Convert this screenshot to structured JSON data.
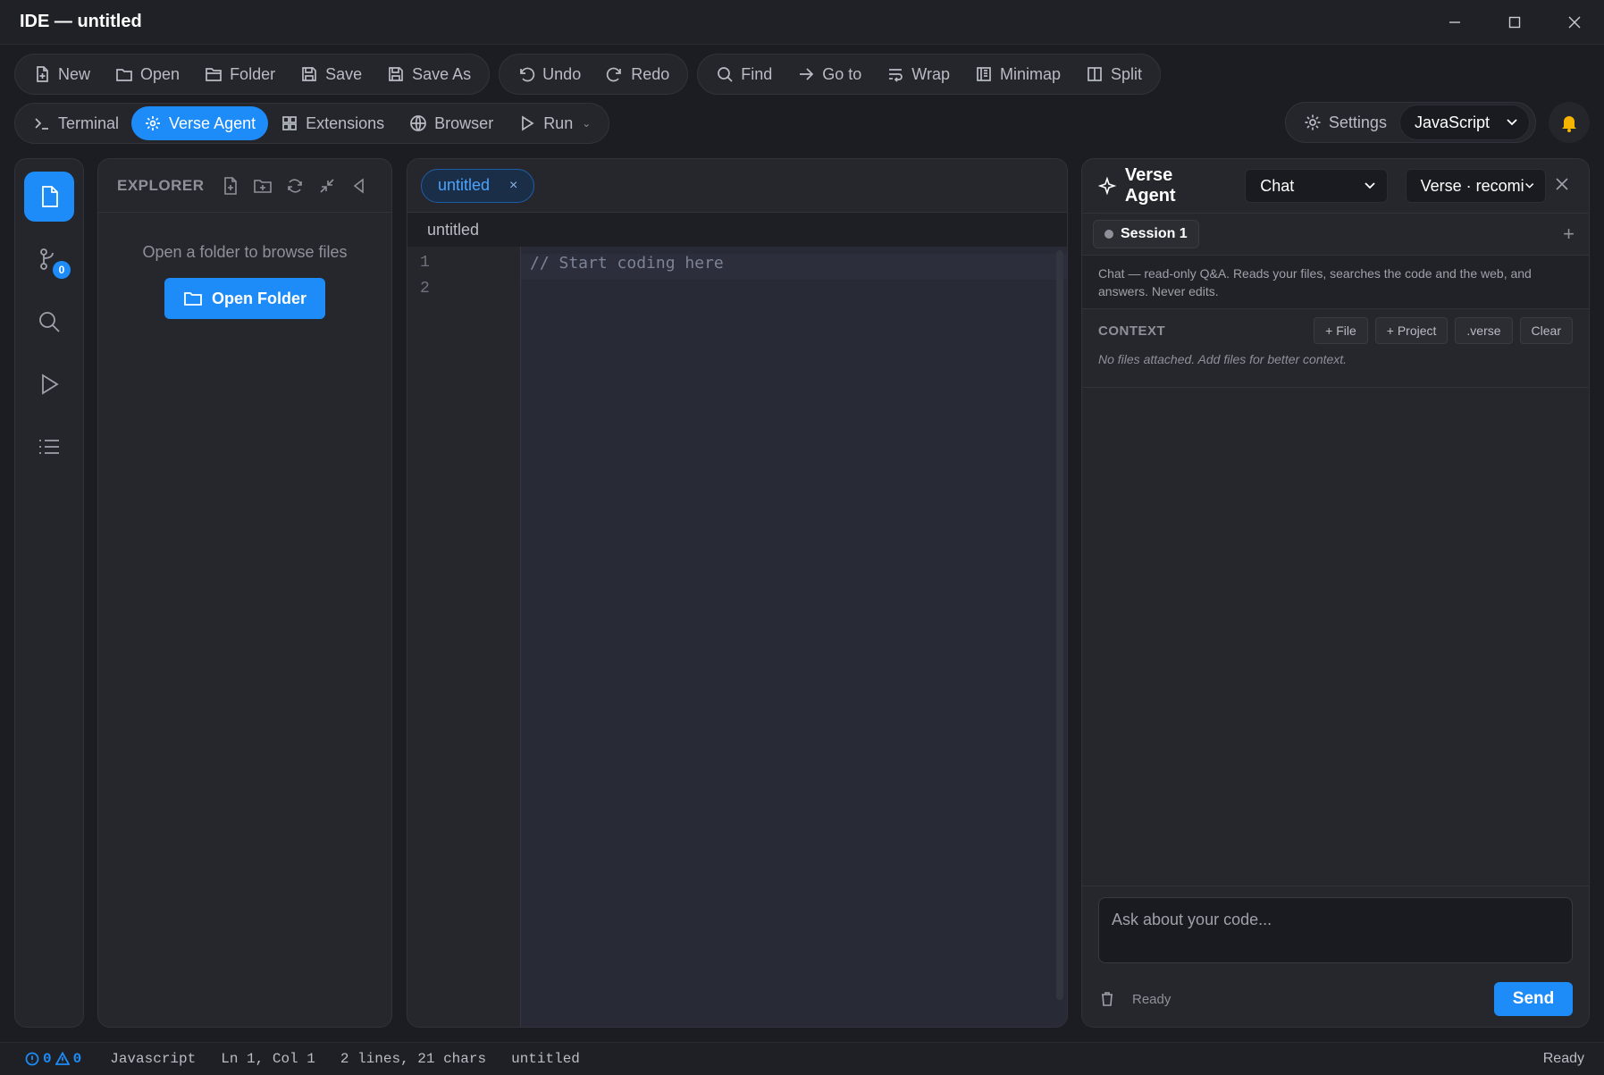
{
  "window": {
    "title": "IDE — untitled"
  },
  "toolbar": {
    "file_group": [
      {
        "label": "New",
        "icon": "new-file-icon"
      },
      {
        "label": "Open",
        "icon": "folder-open-icon"
      },
      {
        "label": "Folder",
        "icon": "folder-icon"
      },
      {
        "label": "Save",
        "icon": "save-icon"
      },
      {
        "label": "Save As",
        "icon": "save-as-icon"
      }
    ],
    "history_group": [
      {
        "label": "Undo",
        "icon": "undo-icon"
      },
      {
        "label": "Redo",
        "icon": "redo-icon"
      }
    ],
    "view_group": [
      {
        "label": "Find",
        "icon": "search-icon"
      },
      {
        "label": "Go to",
        "icon": "arrow-right-icon"
      },
      {
        "label": "Wrap",
        "icon": "wrap-icon"
      },
      {
        "label": "Minimap",
        "icon": "minimap-icon"
      },
      {
        "label": "Split",
        "icon": "split-icon"
      }
    ],
    "panels": [
      {
        "label": "Terminal",
        "icon": "terminal-icon",
        "active": false
      },
      {
        "label": "Verse Agent",
        "icon": "sparkle-icon",
        "active": true
      },
      {
        "label": "Extensions",
        "icon": "grid-icon",
        "active": false
      },
      {
        "label": "Browser",
        "icon": "globe-icon",
        "active": false
      },
      {
        "label": "Run",
        "icon": "play-icon",
        "active": false
      }
    ],
    "settings_label": "Settings",
    "language": "JavaScript"
  },
  "activity": {
    "git_badge": "0"
  },
  "explorer": {
    "title": "EXPLORER",
    "empty_text": "Open a folder to browse files",
    "open_folder_label": "Open Folder"
  },
  "editor": {
    "tab_label": "untitled",
    "breadcrumb": "untitled",
    "line_numbers": [
      "1",
      "2"
    ],
    "lines": [
      "// Start coding here",
      ""
    ]
  },
  "agent": {
    "title": "Verse Agent",
    "mode": "Chat",
    "model": "Verse · recomi",
    "session_label": "Session 1",
    "description": "Chat — read-only Q&A. Reads your files, searches the code and the web, and answers. Never edits.",
    "context_title": "CONTEXT",
    "context_buttons": [
      "+ File",
      "+ Project",
      ".verse",
      "Clear"
    ],
    "context_empty": "No files attached. Add files for better context.",
    "input_placeholder": "Ask about your code...",
    "status": "Ready",
    "send_label": "Send"
  },
  "statusbar": {
    "errors": "0",
    "warnings": "0",
    "language": "Javascript",
    "position": "Ln 1, Col 1",
    "stats": "2 lines, 21 chars",
    "file": "untitled",
    "status": "Ready"
  },
  "colors": {
    "accent": "#1d8cf8",
    "background": "#1c1d22",
    "panel": "#26272d",
    "bell": "#f5b400"
  }
}
